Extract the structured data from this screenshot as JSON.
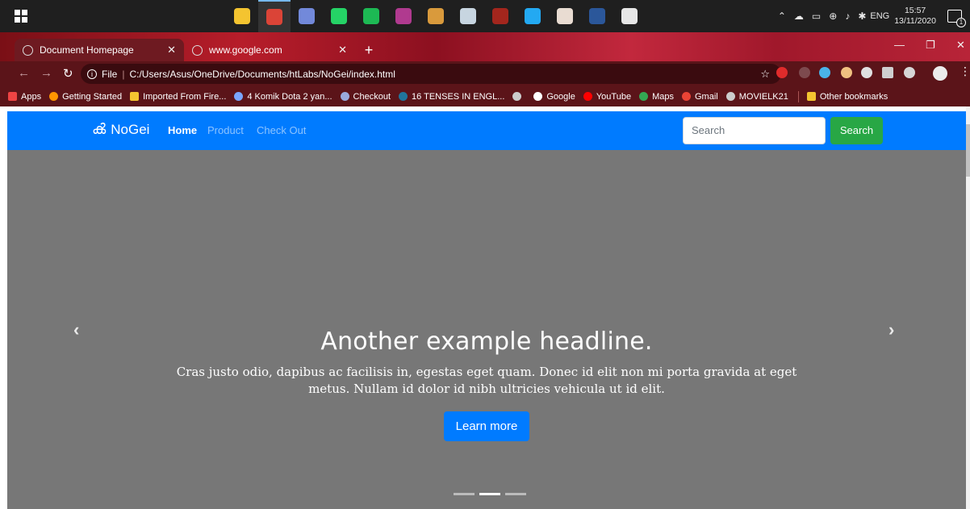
{
  "taskbar": {
    "apps": [
      {
        "name": "file-explorer-icon",
        "color": "#f4c430"
      },
      {
        "name": "chrome-icon",
        "color": "#db4437"
      },
      {
        "name": "discord-icon",
        "color": "#7289da"
      },
      {
        "name": "whatsapp-icon",
        "color": "#25d366"
      },
      {
        "name": "spotify-icon",
        "color": "#1db954"
      },
      {
        "name": "winrar-icon",
        "color": "#b03a8f"
      },
      {
        "name": "paint-icon",
        "color": "#d99a3c"
      },
      {
        "name": "steam-icon",
        "color": "#c7d5e0"
      },
      {
        "name": "dota-icon",
        "color": "#a3261d"
      },
      {
        "name": "vscode-icon",
        "color": "#23a9f2"
      },
      {
        "name": "anime-app-icon",
        "color": "#e9dcd2"
      },
      {
        "name": "word-icon",
        "color": "#2b579a"
      },
      {
        "name": "media-icon",
        "color": "#e6e6e6"
      }
    ],
    "tray": {
      "language": "ENG",
      "time": "15:57",
      "date": "13/11/2020",
      "notification_count": "1"
    }
  },
  "browser": {
    "tabs": [
      {
        "title": "Document Homepage",
        "active": true
      },
      {
        "title": "www.google.com",
        "active": false
      }
    ],
    "address": {
      "scheme_label": "File",
      "url": "C:/Users/Asus/OneDrive/Documents/htLabs/NoGei/index.html"
    },
    "bookmarks": [
      {
        "label": "Apps",
        "icon": "apps-grid-icon",
        "color": "#e44"
      },
      {
        "label": "Getting Started",
        "icon": "firefox-icon",
        "color": "#ff9500"
      },
      {
        "label": "Imported From Fire...",
        "icon": "folder-icon",
        "color": "#f4c430"
      },
      {
        "label": "4 Komik Dota 2 yan...",
        "icon": "site-icon",
        "color": "#7aa6ff"
      },
      {
        "label": "Checkout",
        "icon": "site-icon",
        "color": "#9ad"
      },
      {
        "label": "16 TENSES IN ENGL...",
        "icon": "wordpress-icon",
        "color": "#21759b"
      },
      {
        "label": "",
        "icon": "globe-icon",
        "color": "#ccc"
      },
      {
        "label": "Google",
        "icon": "google-icon",
        "color": "#fff"
      },
      {
        "label": "YouTube",
        "icon": "youtube-icon",
        "color": "#f00"
      },
      {
        "label": "Maps",
        "icon": "maps-icon",
        "color": "#34a853"
      },
      {
        "label": "Gmail",
        "icon": "gmail-icon",
        "color": "#ea4335"
      },
      {
        "label": "MOVIELK21",
        "icon": "globe-icon",
        "color": "#ccc"
      }
    ],
    "other_bookmarks": "Other bookmarks"
  },
  "page": {
    "brand": "NoGei",
    "nav": [
      {
        "label": "Home",
        "active": true
      },
      {
        "label": "Product",
        "active": false
      },
      {
        "label": "Check Out",
        "active": false
      }
    ],
    "search": {
      "placeholder": "Search",
      "button_label": "Search"
    },
    "carousel": {
      "headline": "Another example headline.",
      "text": "Cras justo odio, dapibus ac facilisis in, egestas eget quam. Donec id elit non mi porta gravida at eget metus. Nullam id dolor id nibh ultricies vehicula ut id elit.",
      "button_label": "Learn more",
      "slide_count": 3,
      "active_slide": 2,
      "prev_glyph": "‹",
      "next_glyph": "›"
    },
    "colors": {
      "navbar": "#007bff",
      "search_button": "#28a745",
      "carousel_bg": "#777777"
    }
  }
}
